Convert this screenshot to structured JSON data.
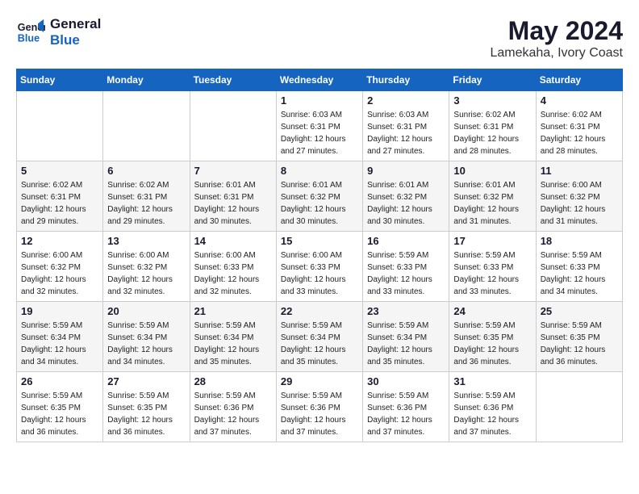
{
  "header": {
    "logo_line1": "General",
    "logo_line2": "Blue",
    "month_year": "May 2024",
    "location": "Lamekaha, Ivory Coast"
  },
  "calendar": {
    "days_of_week": [
      "Sunday",
      "Monday",
      "Tuesday",
      "Wednesday",
      "Thursday",
      "Friday",
      "Saturday"
    ],
    "weeks": [
      [
        {
          "day": "",
          "info": ""
        },
        {
          "day": "",
          "info": ""
        },
        {
          "day": "",
          "info": ""
        },
        {
          "day": "1",
          "info": "Sunrise: 6:03 AM\nSunset: 6:31 PM\nDaylight: 12 hours\nand 27 minutes."
        },
        {
          "day": "2",
          "info": "Sunrise: 6:03 AM\nSunset: 6:31 PM\nDaylight: 12 hours\nand 27 minutes."
        },
        {
          "day": "3",
          "info": "Sunrise: 6:02 AM\nSunset: 6:31 PM\nDaylight: 12 hours\nand 28 minutes."
        },
        {
          "day": "4",
          "info": "Sunrise: 6:02 AM\nSunset: 6:31 PM\nDaylight: 12 hours\nand 28 minutes."
        }
      ],
      [
        {
          "day": "5",
          "info": "Sunrise: 6:02 AM\nSunset: 6:31 PM\nDaylight: 12 hours\nand 29 minutes."
        },
        {
          "day": "6",
          "info": "Sunrise: 6:02 AM\nSunset: 6:31 PM\nDaylight: 12 hours\nand 29 minutes."
        },
        {
          "day": "7",
          "info": "Sunrise: 6:01 AM\nSunset: 6:31 PM\nDaylight: 12 hours\nand 30 minutes."
        },
        {
          "day": "8",
          "info": "Sunrise: 6:01 AM\nSunset: 6:32 PM\nDaylight: 12 hours\nand 30 minutes."
        },
        {
          "day": "9",
          "info": "Sunrise: 6:01 AM\nSunset: 6:32 PM\nDaylight: 12 hours\nand 30 minutes."
        },
        {
          "day": "10",
          "info": "Sunrise: 6:01 AM\nSunset: 6:32 PM\nDaylight: 12 hours\nand 31 minutes."
        },
        {
          "day": "11",
          "info": "Sunrise: 6:00 AM\nSunset: 6:32 PM\nDaylight: 12 hours\nand 31 minutes."
        }
      ],
      [
        {
          "day": "12",
          "info": "Sunrise: 6:00 AM\nSunset: 6:32 PM\nDaylight: 12 hours\nand 32 minutes."
        },
        {
          "day": "13",
          "info": "Sunrise: 6:00 AM\nSunset: 6:32 PM\nDaylight: 12 hours\nand 32 minutes."
        },
        {
          "day": "14",
          "info": "Sunrise: 6:00 AM\nSunset: 6:33 PM\nDaylight: 12 hours\nand 32 minutes."
        },
        {
          "day": "15",
          "info": "Sunrise: 6:00 AM\nSunset: 6:33 PM\nDaylight: 12 hours\nand 33 minutes."
        },
        {
          "day": "16",
          "info": "Sunrise: 5:59 AM\nSunset: 6:33 PM\nDaylight: 12 hours\nand 33 minutes."
        },
        {
          "day": "17",
          "info": "Sunrise: 5:59 AM\nSunset: 6:33 PM\nDaylight: 12 hours\nand 33 minutes."
        },
        {
          "day": "18",
          "info": "Sunrise: 5:59 AM\nSunset: 6:33 PM\nDaylight: 12 hours\nand 34 minutes."
        }
      ],
      [
        {
          "day": "19",
          "info": "Sunrise: 5:59 AM\nSunset: 6:34 PM\nDaylight: 12 hours\nand 34 minutes."
        },
        {
          "day": "20",
          "info": "Sunrise: 5:59 AM\nSunset: 6:34 PM\nDaylight: 12 hours\nand 34 minutes."
        },
        {
          "day": "21",
          "info": "Sunrise: 5:59 AM\nSunset: 6:34 PM\nDaylight: 12 hours\nand 35 minutes."
        },
        {
          "day": "22",
          "info": "Sunrise: 5:59 AM\nSunset: 6:34 PM\nDaylight: 12 hours\nand 35 minutes."
        },
        {
          "day": "23",
          "info": "Sunrise: 5:59 AM\nSunset: 6:34 PM\nDaylight: 12 hours\nand 35 minutes."
        },
        {
          "day": "24",
          "info": "Sunrise: 5:59 AM\nSunset: 6:35 PM\nDaylight: 12 hours\nand 36 minutes."
        },
        {
          "day": "25",
          "info": "Sunrise: 5:59 AM\nSunset: 6:35 PM\nDaylight: 12 hours\nand 36 minutes."
        }
      ],
      [
        {
          "day": "26",
          "info": "Sunrise: 5:59 AM\nSunset: 6:35 PM\nDaylight: 12 hours\nand 36 minutes."
        },
        {
          "day": "27",
          "info": "Sunrise: 5:59 AM\nSunset: 6:35 PM\nDaylight: 12 hours\nand 36 minutes."
        },
        {
          "day": "28",
          "info": "Sunrise: 5:59 AM\nSunset: 6:36 PM\nDaylight: 12 hours\nand 37 minutes."
        },
        {
          "day": "29",
          "info": "Sunrise: 5:59 AM\nSunset: 6:36 PM\nDaylight: 12 hours\nand 37 minutes."
        },
        {
          "day": "30",
          "info": "Sunrise: 5:59 AM\nSunset: 6:36 PM\nDaylight: 12 hours\nand 37 minutes."
        },
        {
          "day": "31",
          "info": "Sunrise: 5:59 AM\nSunset: 6:36 PM\nDaylight: 12 hours\nand 37 minutes."
        },
        {
          "day": "",
          "info": ""
        }
      ]
    ]
  }
}
